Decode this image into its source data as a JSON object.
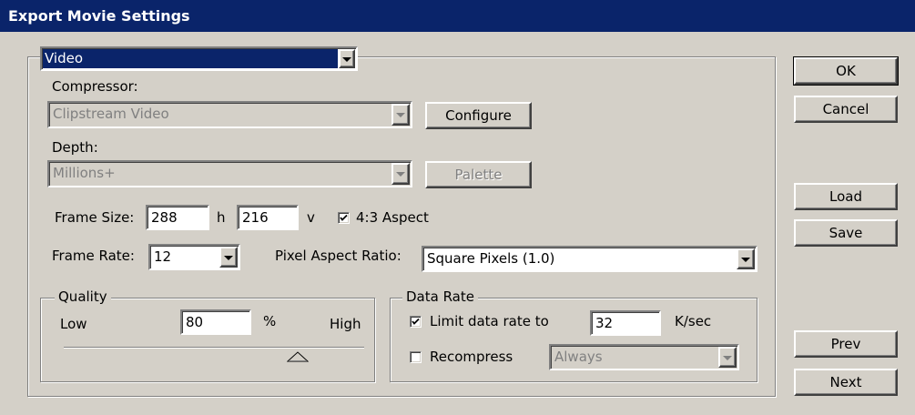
{
  "window": {
    "title": "Export Movie Settings"
  },
  "section": {
    "selected": "Video"
  },
  "compressor": {
    "label": "Compressor:",
    "value": "Clipstream Video",
    "configure_label": "Configure"
  },
  "depth": {
    "label": "Depth:",
    "value": "Millions+",
    "palette_label": "Palette"
  },
  "frame_size": {
    "label": "Frame Size:",
    "h_value": "288",
    "h_label": "h",
    "v_value": "216",
    "v_label": "v",
    "aspect_label": "4:3 Aspect",
    "aspect_checked": true
  },
  "frame_rate": {
    "label": "Frame Rate:",
    "value": "12"
  },
  "pixel_aspect": {
    "label": "Pixel Aspect Ratio:",
    "value": "Square Pixels (1.0)"
  },
  "quality": {
    "legend": "Quality",
    "low_label": "Low",
    "high_label": "High",
    "value": "80",
    "unit": "%",
    "slider_level": 0.8
  },
  "data_rate": {
    "legend": "Data Rate",
    "limit_label": "Limit data rate to",
    "limit_checked": true,
    "limit_value": "32",
    "unit": "K/sec",
    "recompress_label": "Recompress",
    "recompress_checked": false,
    "recompress_value": "Always"
  },
  "buttons": {
    "ok": "OK",
    "cancel": "Cancel",
    "load": "Load",
    "save": "Save",
    "prev": "Prev",
    "next": "Next"
  },
  "colors": {
    "face": "#d4d0c8",
    "titlebar": "#0a246a",
    "highlight": "#0a246a"
  }
}
